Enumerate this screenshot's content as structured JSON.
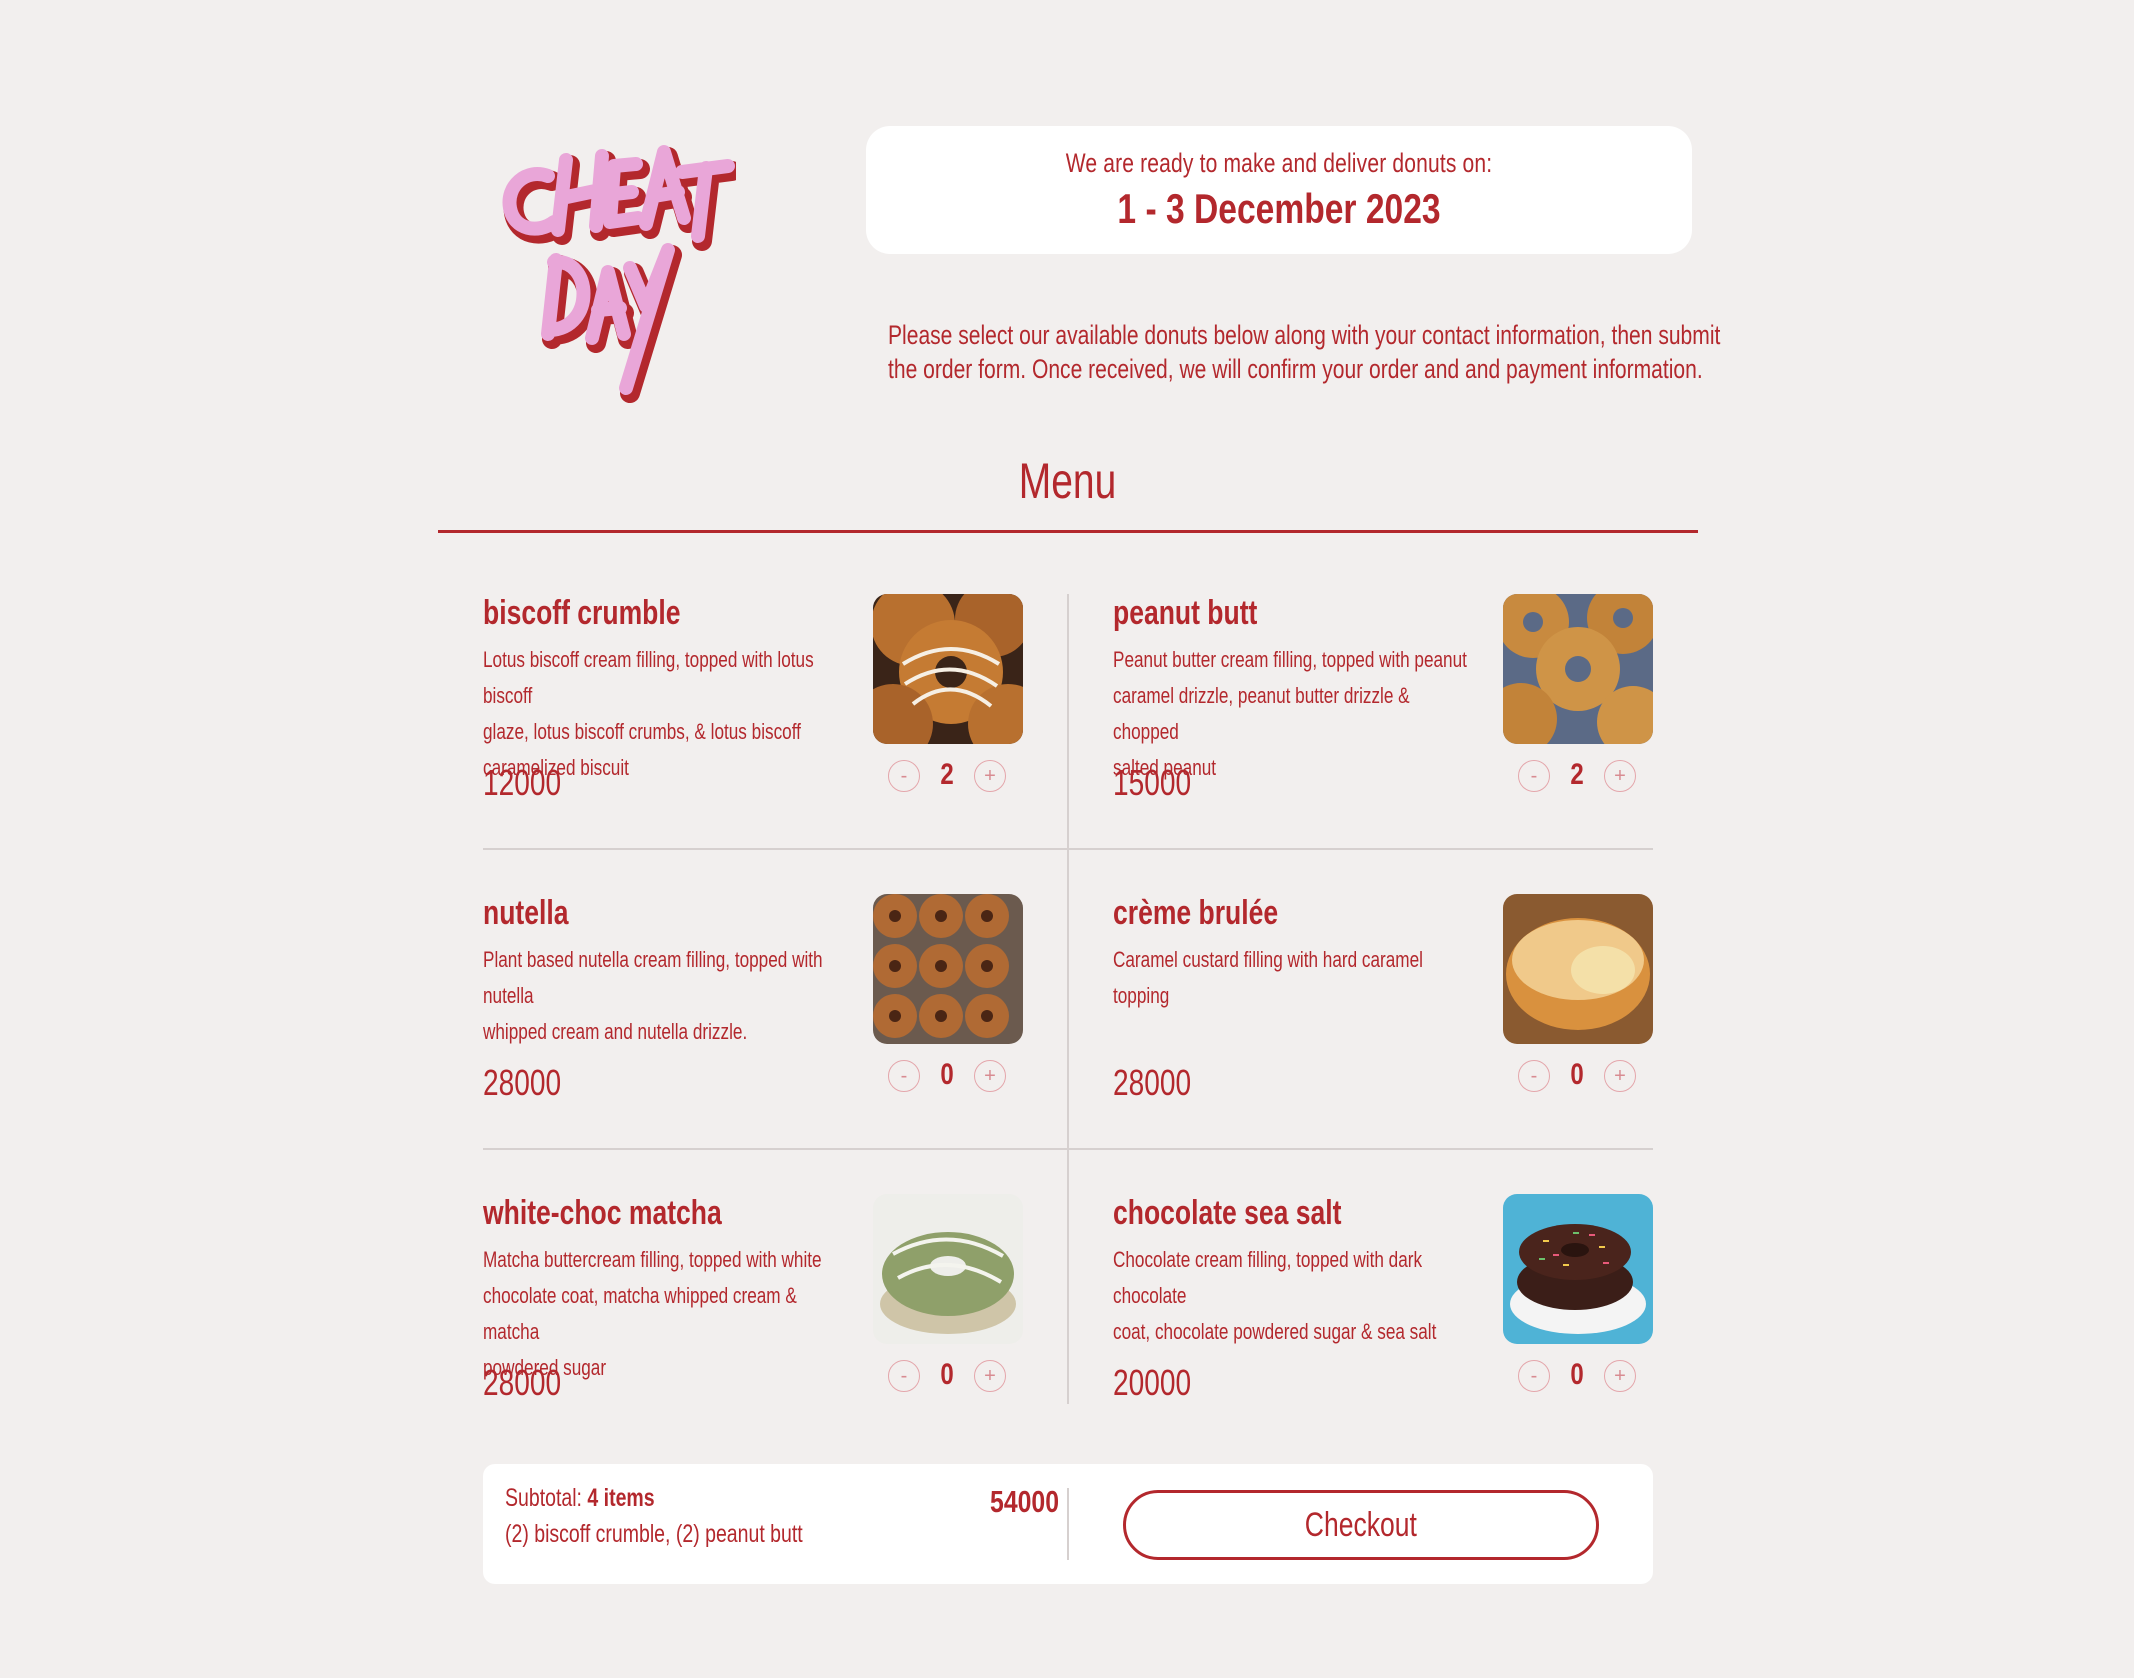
{
  "header": {
    "logo_text": "CHEAT DAY",
    "date_intro": "We are ready to make and deliver donuts on:",
    "date_range": "1 - 3 December 2023",
    "instructions_line1": "Please select our available donuts below along with your contact information, then submit",
    "instructions_line2": "the order form. Once received, we will confirm your order and and payment information."
  },
  "menu": {
    "title": "Menu",
    "items": [
      {
        "name": "biscoff crumble",
        "desc1": "Lotus biscoff cream filling, topped with lotus biscoff",
        "desc2": "glaze, lotus biscoff crumbs, & lotus biscoff",
        "desc3": "caramelized biscuit",
        "price": "12000",
        "qty": "2",
        "image": "donut-biscoff-photo"
      },
      {
        "name": "peanut butt",
        "desc1": "Peanut butter cream filling, topped with peanut",
        "desc2": "caramel drizzle, peanut butter drizzle & chopped",
        "desc3": "salted peanut",
        "price": "15000",
        "qty": "2",
        "image": "donut-peanut-photo"
      },
      {
        "name": "nutella",
        "desc1": "Plant based nutella cream filling, topped with nutella",
        "desc2": "whipped cream and nutella drizzle.",
        "desc3": "",
        "price": "28000",
        "qty": "0",
        "image": "donut-nutella-photo"
      },
      {
        "name": "crème brulée",
        "desc1": "Caramel custard filling with hard caramel topping",
        "desc2": "",
        "desc3": "",
        "price": "28000",
        "qty": "0",
        "image": "donut-creme-brulee-photo"
      },
      {
        "name": "white-choc matcha",
        "desc1": "Matcha buttercream filling, topped with white",
        "desc2": "chocolate coat, matcha whipped cream & matcha",
        "desc3": "powdered sugar",
        "price": "28000",
        "qty": "0",
        "image": "donut-matcha-photo"
      },
      {
        "name": "chocolate sea salt",
        "desc1": "Chocolate cream filling, topped with dark chocolate",
        "desc2": "coat, chocolate powdered sugar & sea salt",
        "desc3": "",
        "price": "20000",
        "qty": "0",
        "image": "donut-chocolate-photo"
      }
    ],
    "minus_label": "-",
    "plus_label": "+"
  },
  "footer": {
    "subtotal_label": "Subtotal:",
    "items_count": "4 items",
    "summary": "(2) biscoff crumble, (2) peanut butt",
    "total": "54000",
    "checkout_label": "Checkout"
  },
  "colors": {
    "background": "#f2efee",
    "accent": "#b3282d",
    "logo_pink": "#e9a6d8",
    "card": "#ffffff"
  }
}
